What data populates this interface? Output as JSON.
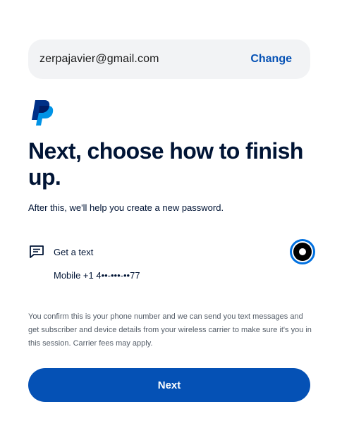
{
  "account": {
    "email": "zerpajavier@gmail.com",
    "change_label": "Change"
  },
  "logo": {
    "icon": "paypal-logo-icon",
    "colors": {
      "dark": "#003087",
      "light": "#0093e6"
    }
  },
  "heading": {
    "title": "Next, choose how to finish up.",
    "subtitle": "After this, we'll help you create a new password."
  },
  "options": [
    {
      "icon": "message-icon",
      "label": "Get a text",
      "detail": "Mobile +1 4••-•••-••77",
      "selected": true
    }
  ],
  "disclaimer": "You confirm this is your phone number and we can send you text messages and get subscriber and device details from your wireless carrier to make sure it's you in this session. Carrier fees may apply.",
  "primary_button": {
    "label": "Next"
  },
  "colors": {
    "accent": "#0551b5",
    "radio_ring": "#0070e0",
    "text": "#001435",
    "muted_text": "#545d68",
    "field_bg": "#f2f3f5"
  }
}
